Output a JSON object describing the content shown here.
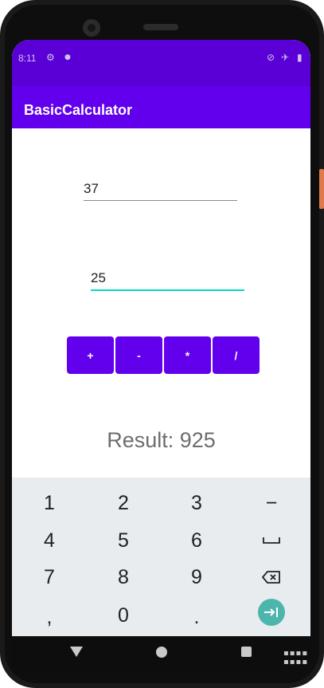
{
  "status": {
    "time": "8:11"
  },
  "app": {
    "title": "BasicCalculator"
  },
  "inputs": {
    "first": "37",
    "second": "25"
  },
  "operations": [
    "+",
    "-",
    "*",
    "/"
  ],
  "result": "Result: 925",
  "keyboard": {
    "rows": [
      [
        "1",
        "2",
        "3",
        "−"
      ],
      [
        "4",
        "5",
        "6",
        "space"
      ],
      [
        "7",
        "8",
        "9",
        "backspace"
      ],
      [
        ",",
        "0",
        ".",
        "enter"
      ]
    ],
    "accent": "#4db6ac"
  },
  "colors": {
    "primary": "#6200ee",
    "status_bar": "#5a00d6",
    "accent": "#03dac5"
  }
}
